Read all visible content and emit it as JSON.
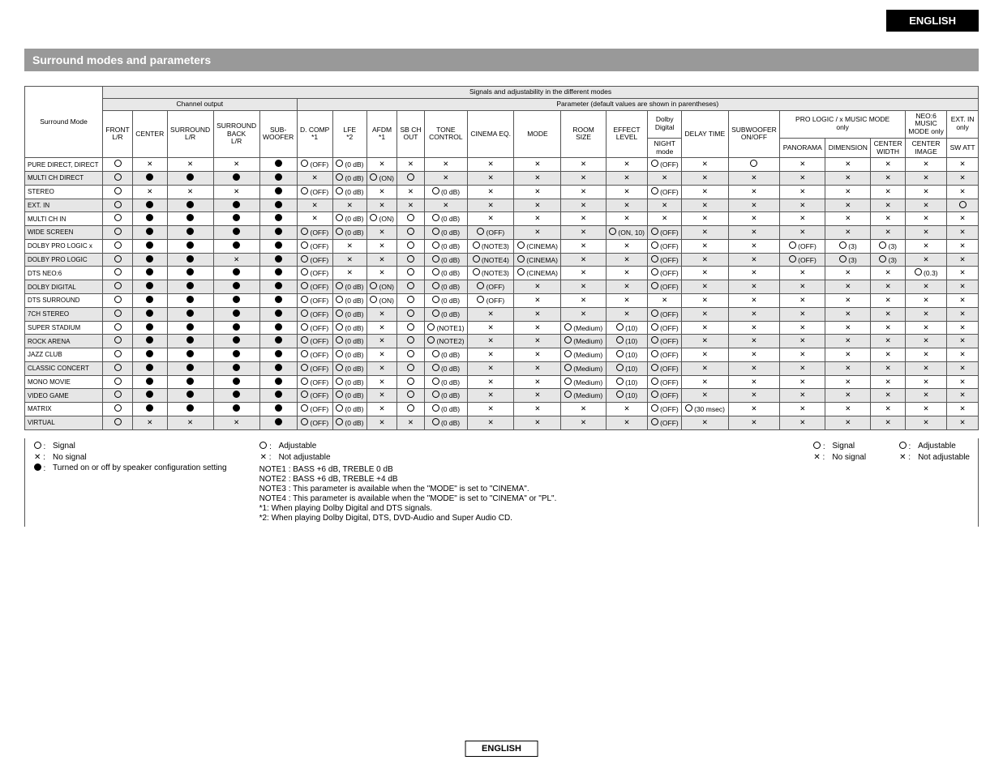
{
  "lang_tab": "ENGLISH",
  "title": "Surround modes and parameters",
  "footer_lang": "ENGLISH",
  "headers": {
    "sig_adj": "Signals and adjustability in the different modes",
    "surround_mode": "Surround Mode",
    "channel_output": "Channel output",
    "parameter": "Parameter (default values are shown in parentheses)",
    "front_lr": "FRONT\nL/R",
    "center": "CENTER",
    "surround_lr": "SURROUND\nL/R",
    "surround_back_lr": "SURROUND\nBACK\nL/R",
    "subwoofer": "SUB-\nWOOFER",
    "dcomp": "D. COMP\n*1",
    "lfe": "LFE\n*2",
    "afdm": "AFDM\n*1",
    "sb_ch_out": "SB CH\nOUT",
    "tone_control": "TONE\nCONTROL",
    "cinema_eq": "CINEMA EQ.",
    "mode": "MODE",
    "room_size": "ROOM\nSIZE",
    "effect_level": "EFFECT\nLEVEL",
    "dolby_digital": "Dolby\nDigital",
    "night_mode": "NIGHT\nmode",
    "delay_time": "DELAY TIME",
    "subwoofer_onoff": "SUBWOOFER\nON/OFF",
    "prologic_music": "PRO LOGIC / x MUSIC MODE\nonly",
    "panorama": "PANORAMA",
    "dimension": "DIMENSION",
    "center_width": "CENTER\nWIDTH",
    "neo6_music": "NEO:6\nMUSIC\nMODE only",
    "center_image": "CENTER\nIMAGE",
    "ext_in_only": "EXT. IN\nonly",
    "sw_att": "SW ATT"
  },
  "row_names": [
    "PURE DIRECT, DIRECT",
    "MULTI CH DIRECT",
    "STEREO",
    "EXT. IN",
    "MULTI CH IN",
    "WIDE SCREEN",
    "DOLBY PRO LOGIC  x",
    "DOLBY PRO LOGIC",
    "DTS NEO:6",
    "DOLBY DIGITAL",
    "DTS SURROUND",
    "7CH STEREO",
    "SUPER STADIUM",
    "ROCK ARENA",
    "JAZZ CLUB",
    "CLASSIC CONCERT",
    "MONO MOVIE",
    "VIDEO GAME",
    "MATRIX",
    "VIRTUAL"
  ],
  "chart_data": {
    "type": "table",
    "legend_symbols": {
      "O": "circle",
      "X": "cross",
      "DOT": "filled-circle"
    },
    "columns": [
      "FRONT L/R",
      "CENTER",
      "SURROUND L/R",
      "SURROUND BACK L/R",
      "SUB-WOOFER",
      "D. COMP",
      "LFE",
      "AFDM",
      "SB CH OUT",
      "TONE CONTROL",
      "CINEMA EQ.",
      "MODE",
      "ROOM SIZE",
      "EFFECT LEVEL",
      "Dolby Digital / NIGHT mode",
      "DELAY TIME",
      "SUBWOOFER ON/OFF",
      "PANORAMA",
      "DIMENSION",
      "CENTER WIDTH",
      "CENTER IMAGE",
      "SW ATT"
    ],
    "rows": [
      {
        "name": "PURE DIRECT, DIRECT",
        "cells": [
          "O",
          "X",
          "X",
          "X",
          "DOT",
          "O (OFF)",
          "O (0 dB)",
          "X",
          "X",
          "X",
          "X",
          "X",
          "X",
          "X",
          "O (OFF)",
          "X",
          "O",
          "X",
          "X",
          "X",
          "X",
          "X"
        ]
      },
      {
        "name": "MULTI CH DIRECT",
        "cells": [
          "O",
          "DOT",
          "DOT",
          "DOT",
          "DOT",
          "X",
          "O (0 dB)",
          "O (ON)",
          "O",
          "X",
          "X",
          "X",
          "X",
          "X",
          "X",
          "X",
          "X",
          "X",
          "X",
          "X",
          "X",
          "X"
        ]
      },
      {
        "name": "STEREO",
        "cells": [
          "O",
          "X",
          "X",
          "X",
          "DOT",
          "O (OFF)",
          "O (0 dB)",
          "X",
          "X",
          "O (0 dB)",
          "X",
          "X",
          "X",
          "X",
          "O (OFF)",
          "X",
          "X",
          "X",
          "X",
          "X",
          "X",
          "X"
        ]
      },
      {
        "name": "EXT. IN",
        "cells": [
          "O",
          "DOT",
          "DOT",
          "DOT",
          "DOT",
          "X",
          "X",
          "X",
          "X",
          "X",
          "X",
          "X",
          "X",
          "X",
          "X",
          "X",
          "X",
          "X",
          "X",
          "X",
          "X",
          "O"
        ]
      },
      {
        "name": "MULTI CH IN",
        "cells": [
          "O",
          "DOT",
          "DOT",
          "DOT",
          "DOT",
          "X",
          "O (0 dB)",
          "O (ON)",
          "O",
          "O (0 dB)",
          "X",
          "X",
          "X",
          "X",
          "X",
          "X",
          "X",
          "X",
          "X",
          "X",
          "X",
          "X"
        ]
      },
      {
        "name": "WIDE SCREEN",
        "cells": [
          "O",
          "DOT",
          "DOT",
          "DOT",
          "DOT",
          "O (OFF)",
          "O (0 dB)",
          "X",
          "O",
          "O (0 dB)",
          "O (OFF)",
          "X",
          "X",
          "O (ON, 10)",
          "O (OFF)",
          "X",
          "X",
          "X",
          "X",
          "X",
          "X",
          "X"
        ]
      },
      {
        "name": "DOLBY PRO LOGIC  x",
        "cells": [
          "O",
          "DOT",
          "DOT",
          "DOT",
          "DOT",
          "O (OFF)",
          "X",
          "X",
          "O",
          "O (0 dB)",
          "O (NOTE3)",
          "O (CINEMA)",
          "X",
          "X",
          "O (OFF)",
          "X",
          "X",
          "O (OFF)",
          "O (3)",
          "O (3)",
          "X",
          "X"
        ]
      },
      {
        "name": "DOLBY PRO LOGIC",
        "cells": [
          "O",
          "DOT",
          "DOT",
          "X",
          "DOT",
          "O (OFF)",
          "X",
          "X",
          "O",
          "O (0 dB)",
          "O (NOTE4)",
          "O (CINEMA)",
          "X",
          "X",
          "O (OFF)",
          "X",
          "X",
          "O (OFF)",
          "O (3)",
          "O (3)",
          "X",
          "X"
        ]
      },
      {
        "name": "DTS NEO:6",
        "cells": [
          "O",
          "DOT",
          "DOT",
          "DOT",
          "DOT",
          "O (OFF)",
          "X",
          "X",
          "O",
          "O (0 dB)",
          "O (NOTE3)",
          "O (CINEMA)",
          "X",
          "X",
          "O (OFF)",
          "X",
          "X",
          "X",
          "X",
          "X",
          "O (0.3)",
          "X"
        ]
      },
      {
        "name": "DOLBY DIGITAL",
        "cells": [
          "O",
          "DOT",
          "DOT",
          "DOT",
          "DOT",
          "O (OFF)",
          "O (0 dB)",
          "O (ON)",
          "O",
          "O (0 dB)",
          "O (OFF)",
          "X",
          "X",
          "X",
          "O (OFF)",
          "X",
          "X",
          "X",
          "X",
          "X",
          "X",
          "X"
        ]
      },
      {
        "name": "DTS SURROUND",
        "cells": [
          "O",
          "DOT",
          "DOT",
          "DOT",
          "DOT",
          "O (OFF)",
          "O (0 dB)",
          "O (ON)",
          "O",
          "O (0 dB)",
          "O (OFF)",
          "X",
          "X",
          "X",
          "X",
          "X",
          "X",
          "X",
          "X",
          "X",
          "X",
          "X"
        ]
      },
      {
        "name": "7CH STEREO",
        "cells": [
          "O",
          "DOT",
          "DOT",
          "DOT",
          "DOT",
          "O (OFF)",
          "O (0 dB)",
          "X",
          "O",
          "O (0 dB)",
          "X",
          "X",
          "X",
          "X",
          "O (OFF)",
          "X",
          "X",
          "X",
          "X",
          "X",
          "X",
          "X"
        ]
      },
      {
        "name": "SUPER STADIUM",
        "cells": [
          "O",
          "DOT",
          "DOT",
          "DOT",
          "DOT",
          "O (OFF)",
          "O (0 dB)",
          "X",
          "O",
          "O (NOTE1)",
          "X",
          "X",
          "O (Medium)",
          "O (10)",
          "O (OFF)",
          "X",
          "X",
          "X",
          "X",
          "X",
          "X",
          "X"
        ]
      },
      {
        "name": "ROCK ARENA",
        "cells": [
          "O",
          "DOT",
          "DOT",
          "DOT",
          "DOT",
          "O (OFF)",
          "O (0 dB)",
          "X",
          "O",
          "O (NOTE2)",
          "X",
          "X",
          "O (Medium)",
          "O (10)",
          "O (OFF)",
          "X",
          "X",
          "X",
          "X",
          "X",
          "X",
          "X"
        ]
      },
      {
        "name": "JAZZ CLUB",
        "cells": [
          "O",
          "DOT",
          "DOT",
          "DOT",
          "DOT",
          "O (OFF)",
          "O (0 dB)",
          "X",
          "O",
          "O (0 dB)",
          "X",
          "X",
          "O (Medium)",
          "O (10)",
          "O (OFF)",
          "X",
          "X",
          "X",
          "X",
          "X",
          "X",
          "X"
        ]
      },
      {
        "name": "CLASSIC CONCERT",
        "cells": [
          "O",
          "DOT",
          "DOT",
          "DOT",
          "DOT",
          "O (OFF)",
          "O (0 dB)",
          "X",
          "O",
          "O (0 dB)",
          "X",
          "X",
          "O (Medium)",
          "O (10)",
          "O (OFF)",
          "X",
          "X",
          "X",
          "X",
          "X",
          "X",
          "X"
        ]
      },
      {
        "name": "MONO MOVIE",
        "cells": [
          "O",
          "DOT",
          "DOT",
          "DOT",
          "DOT",
          "O (OFF)",
          "O (0 dB)",
          "X",
          "O",
          "O (0 dB)",
          "X",
          "X",
          "O (Medium)",
          "O (10)",
          "O (OFF)",
          "X",
          "X",
          "X",
          "X",
          "X",
          "X",
          "X"
        ]
      },
      {
        "name": "VIDEO GAME",
        "cells": [
          "O",
          "DOT",
          "DOT",
          "DOT",
          "DOT",
          "O (OFF)",
          "O (0 dB)",
          "X",
          "O",
          "O (0 dB)",
          "X",
          "X",
          "O (Medium)",
          "O (10)",
          "O (OFF)",
          "X",
          "X",
          "X",
          "X",
          "X",
          "X",
          "X"
        ]
      },
      {
        "name": "MATRIX",
        "cells": [
          "O",
          "DOT",
          "DOT",
          "DOT",
          "DOT",
          "O (OFF)",
          "O (0 dB)",
          "X",
          "O",
          "O (0 dB)",
          "X",
          "X",
          "X",
          "X",
          "O (OFF)",
          "O (30 msec)",
          "X",
          "X",
          "X",
          "X",
          "X",
          "X"
        ]
      },
      {
        "name": "VIRTUAL",
        "cells": [
          "O",
          "X",
          "X",
          "X",
          "DOT",
          "O (OFF)",
          "O (0 dB)",
          "X",
          "X",
          "O (0 dB)",
          "X",
          "X",
          "X",
          "X",
          "O (OFF)",
          "X",
          "X",
          "X",
          "X",
          "X",
          "X",
          "X"
        ]
      }
    ]
  },
  "legend": {
    "col1": [
      {
        "sym": "O",
        "text": "Signal"
      },
      {
        "sym": "X",
        "text": "No signal"
      },
      {
        "sym": "DOT",
        "text": "Turned on or off by speaker configuration setting"
      }
    ],
    "col2": [
      {
        "sym": "O",
        "text": "Adjustable"
      },
      {
        "sym": "X",
        "text": "Not adjustable"
      }
    ],
    "notes": [
      "NOTE1 : BASS +6 dB, TREBLE 0 dB",
      "NOTE2 : BASS +6 dB, TREBLE +4 dB",
      "NOTE3 : This parameter is available when the \"MODE\" is set to \"CINEMA\".",
      "NOTE4 : This parameter is available when the \"MODE\" is set to \"CINEMA\" or \"PL\".",
      "*1:  When playing Dolby Digital and DTS signals.",
      "*2:  When playing Dolby Digital, DTS, DVD-Audio and Super Audio CD."
    ],
    "col3": [
      {
        "sym": "O",
        "text": "Signal"
      },
      {
        "sym": "X",
        "text": "No signal"
      }
    ],
    "col4": [
      {
        "sym": "O",
        "text": "Adjustable"
      },
      {
        "sym": "X",
        "text": "Not adjustable"
      }
    ]
  }
}
